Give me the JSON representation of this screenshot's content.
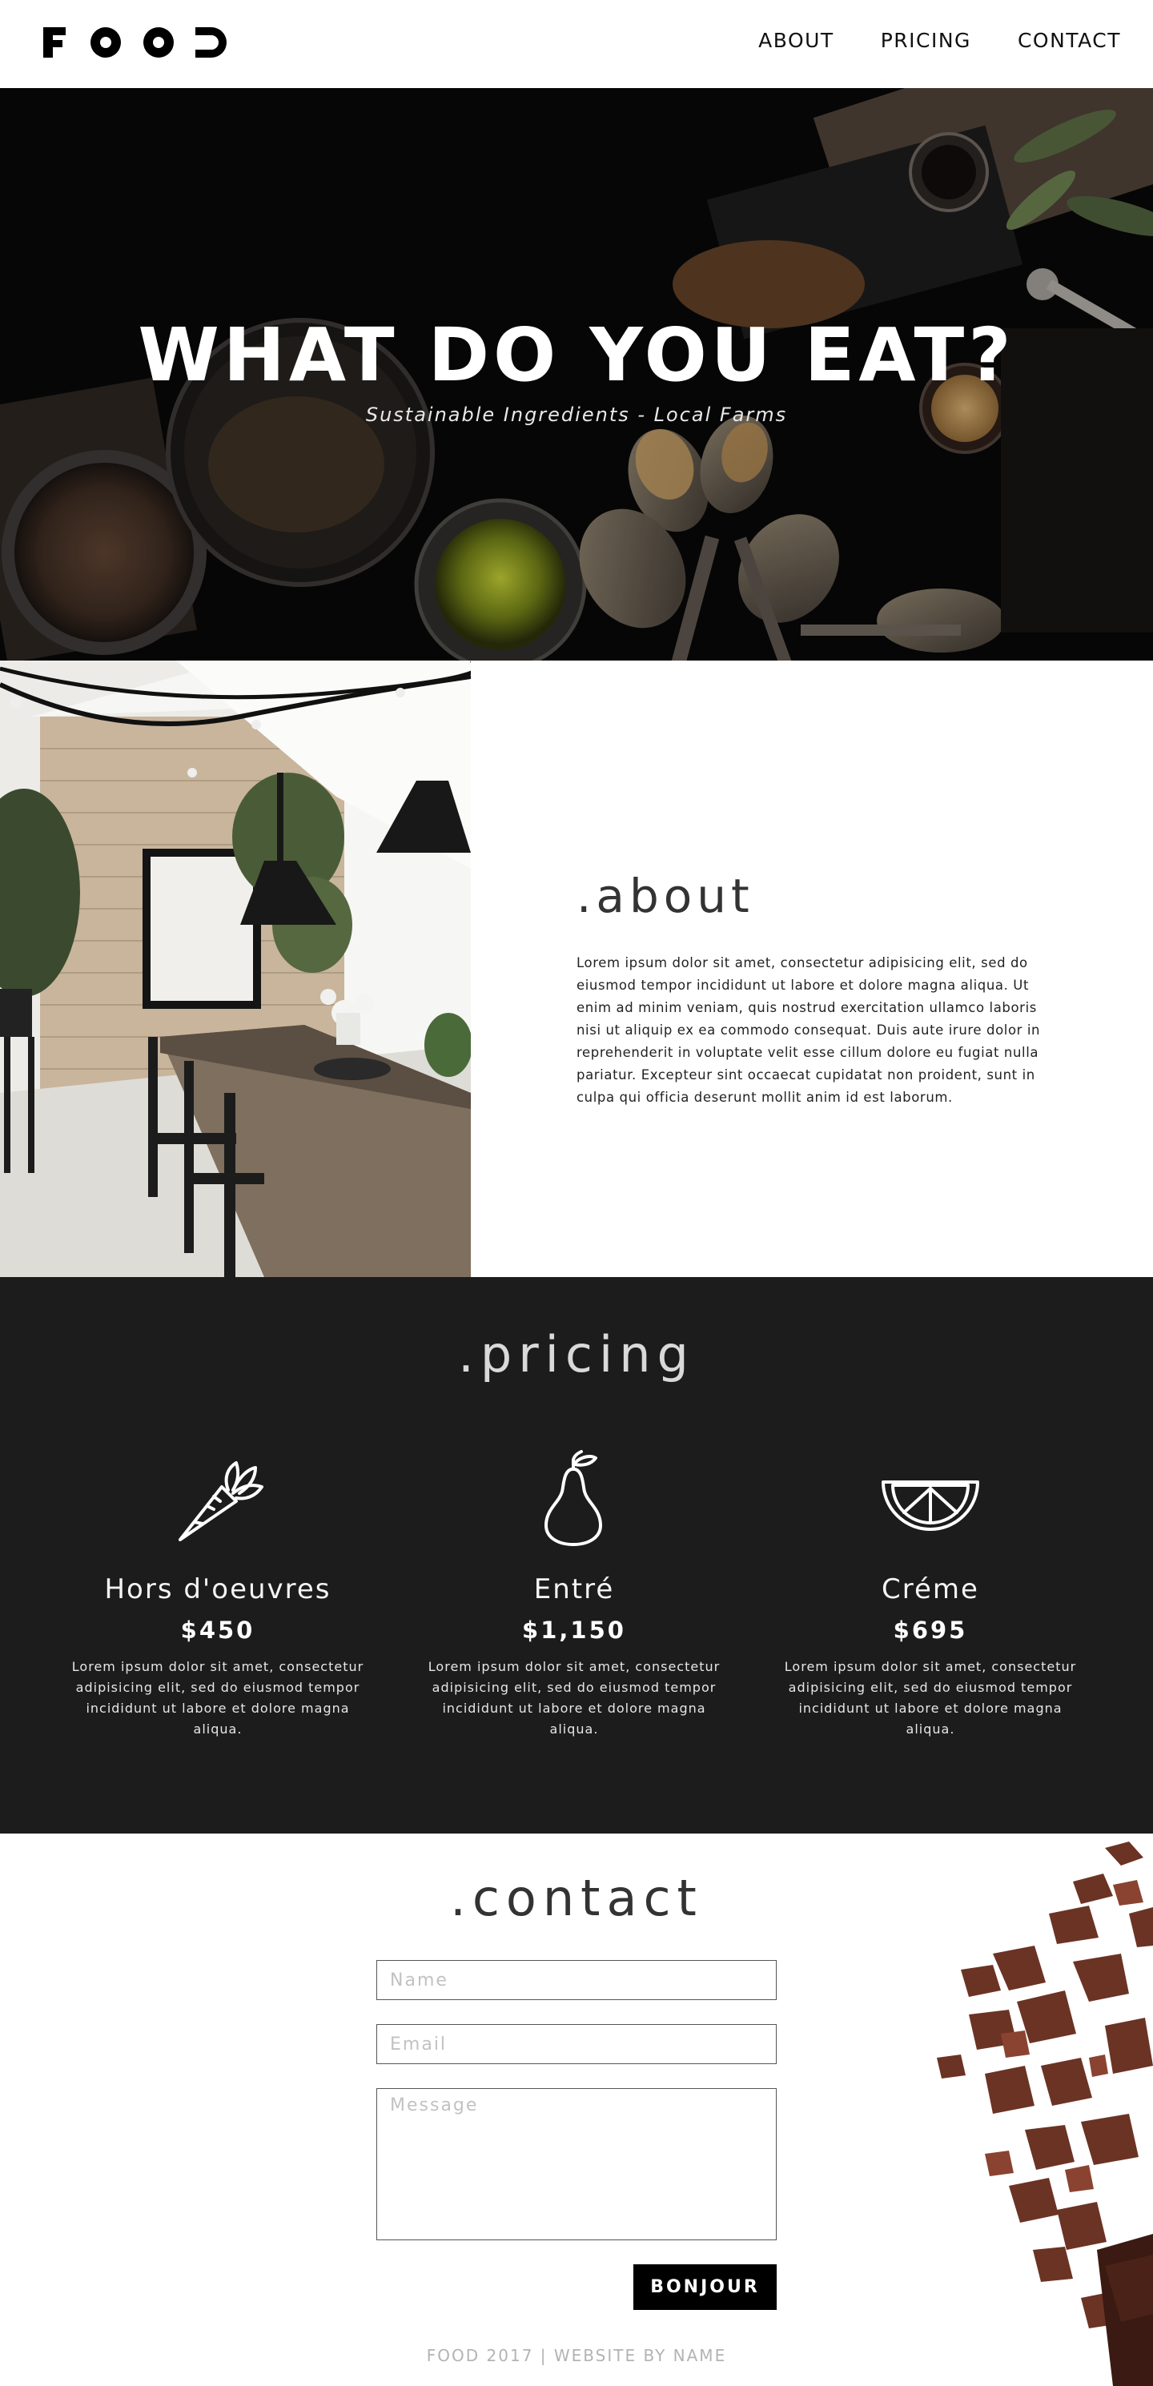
{
  "header": {
    "logo_text": "FOOD",
    "nav": [
      {
        "label": "ABOUT"
      },
      {
        "label": "PRICING"
      },
      {
        "label": "CONTACT"
      }
    ]
  },
  "hero": {
    "title": "WHAT DO YOU EAT?",
    "subtitle": "Sustainable Ingredients - Local Farms"
  },
  "about": {
    "title": ".about",
    "body": "Lorem ipsum dolor sit amet, consectetur adipisicing elit, sed do eiusmod tempor incididunt ut labore et dolore magna aliqua. Ut enim ad minim veniam, quis nostrud exercitation ullamco laboris nisi ut aliquip ex ea commodo consequat. Duis aute irure dolor in reprehenderit in voluptate velit esse cillum dolore eu fugiat nulla pariatur. Excepteur sint occaecat cupidatat non proident, sunt in culpa qui officia deserunt mollit anim id est laborum."
  },
  "pricing": {
    "title": ".pricing",
    "items": [
      {
        "icon": "carrot-icon",
        "name": "Hors d'oeuvres",
        "price": "$450",
        "desc": "Lorem ipsum dolor sit amet, consectetur adipisicing elit, sed do eiusmod tempor incididunt ut labore et dolore magna aliqua."
      },
      {
        "icon": "pear-icon",
        "name": "Entré",
        "price": "$1,150",
        "desc": "Lorem ipsum dolor sit amet, consectetur adipisicing elit, sed do eiusmod tempor incididunt ut labore et dolore magna aliqua."
      },
      {
        "icon": "lemon-slice-icon",
        "name": "Créme",
        "price": "$695",
        "desc": "Lorem ipsum dolor sit amet, consectetur adipisicing elit, sed do eiusmod tempor incididunt ut labore et dolore magna aliqua."
      }
    ]
  },
  "contact": {
    "title": ".contact",
    "name_placeholder": "Name",
    "email_placeholder": "Email",
    "message_placeholder": "Message",
    "submit_label": "BONJOUR"
  },
  "footer": {
    "text": "FOOD 2017  |  WEBSITE BY NAME"
  },
  "colors": {
    "header_bg": "#ffffff",
    "hero_bg": "#070707",
    "pricing_bg": "#1c1c1c",
    "button_bg": "#000000",
    "footer_text": "#b3b3b3"
  }
}
